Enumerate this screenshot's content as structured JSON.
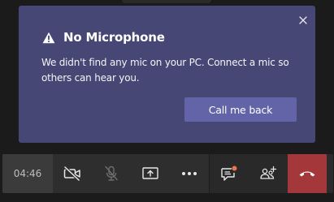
{
  "notice": {
    "title": "No Microphone",
    "message": "We didn't find any mic on your PC. Connect a mic so others can hear you.",
    "action_label": "Call me back",
    "icons": {
      "close": "close-icon",
      "warning": "warning-icon"
    }
  },
  "call_bar": {
    "timer": "04:46",
    "controls": [
      {
        "name": "camera-off",
        "icon": "camera-off-icon"
      },
      {
        "name": "mic-off",
        "icon": "mic-off-icon"
      },
      {
        "name": "share-screen",
        "icon": "share-screen-icon"
      },
      {
        "name": "more-options",
        "icon": "more-icon"
      },
      {
        "name": "chat",
        "icon": "chat-icon",
        "has_notification": true
      },
      {
        "name": "participants",
        "icon": "add-people-icon"
      },
      {
        "name": "hang-up",
        "icon": "hang-up-icon"
      }
    ]
  },
  "colors": {
    "notice_bg": "#464775",
    "button_bg": "#6264a7",
    "hangup_bg": "#a4373a",
    "notification_dot": "#e97548",
    "background": "#1b1b1b"
  }
}
